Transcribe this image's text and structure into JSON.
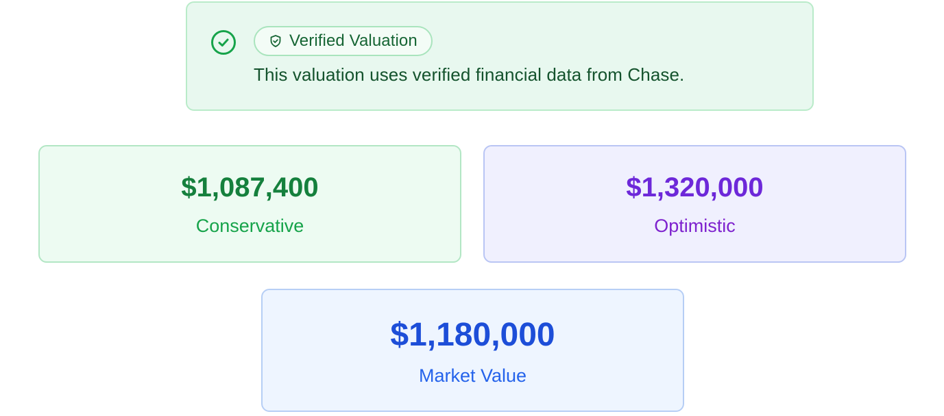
{
  "banner": {
    "check_icon": "check-circle-icon",
    "badge_icon": "shield-check-icon",
    "badge_label": "Verified Valuation",
    "message": "This valuation uses verified financial data from Chase.",
    "colors": {
      "background": "#e8f8ef",
      "border": "#b9ebc9",
      "icon": "#16a34a",
      "text": "#14532d"
    }
  },
  "valuations": {
    "conservative": {
      "amount": "$1,087,400",
      "label": "Conservative",
      "color": "#15803d"
    },
    "optimistic": {
      "amount": "$1,320,000",
      "label": "Optimistic",
      "color": "#6d28d9"
    },
    "market": {
      "amount": "$1,180,000",
      "label": "Market Value",
      "color": "#1d4ed8"
    }
  }
}
